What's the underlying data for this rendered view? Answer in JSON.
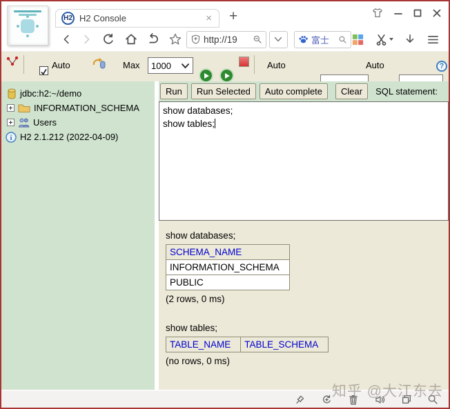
{
  "colors": {
    "frame_border": "#a93434",
    "sidebar_bg": "#cfe3cf",
    "panel_bg": "#ece9d8",
    "table_link_blue": "#0000cc",
    "run_green": "#2f8b2f",
    "stop_red": "#d23535"
  },
  "window": {
    "tab_title": "H2 Console",
    "tab_logo": "H2",
    "tab_close_glyph": "×",
    "new_tab_label": "+"
  },
  "browser": {
    "address_url": "http://19",
    "search_query": "富士"
  },
  "h2_toolbar": {
    "autocommit_label": "Auto",
    "max_rows_label": "Max",
    "max_rows_value": "1000",
    "auto_select_label": "Auto",
    "autocomplete_label": "Auto",
    "help_label": "?"
  },
  "sidebar": {
    "items": [
      {
        "label": "jdbc:h2:~/demo",
        "icon": "database-icon"
      },
      {
        "label": "INFORMATION_SCHEMA",
        "icon": "folder-icon",
        "expander": "+"
      },
      {
        "label": "Users",
        "icon": "users-icon",
        "expander": "+"
      },
      {
        "label": "H2 2.1.212 (2022-04-09)",
        "icon": "info-icon"
      }
    ]
  },
  "query_toolbar": {
    "run": "Run",
    "run_selected": "Run Selected",
    "auto_complete": "Auto complete",
    "clear": "Clear",
    "sql_label": "SQL statement:"
  },
  "sql_editor": {
    "line1": "show databases;",
    "line2": "show tables;"
  },
  "results": [
    {
      "query": "show databases;",
      "columns": [
        "SCHEMA_NAME"
      ],
      "rows": [
        [
          "INFORMATION_SCHEMA"
        ],
        [
          "PUBLIC"
        ]
      ],
      "status": "(2 rows, 0 ms)"
    },
    {
      "query": "show tables;",
      "columns": [
        "TABLE_NAME",
        "TABLE_SCHEMA"
      ],
      "rows": [],
      "status": "(no rows, 0 ms)"
    }
  ],
  "watermark": "知乎 @大江东去"
}
